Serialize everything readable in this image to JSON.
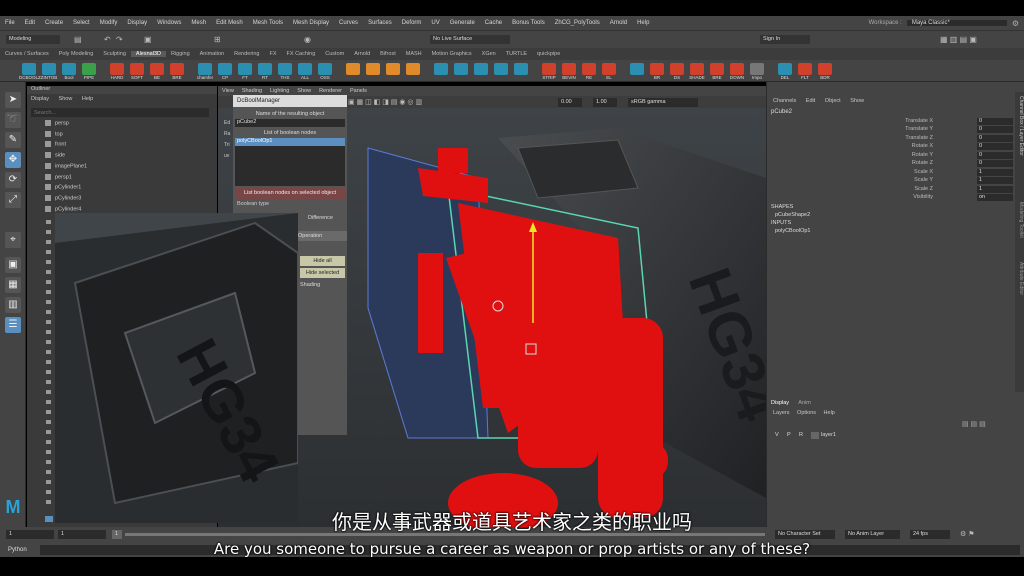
{
  "menu": [
    "File",
    "Edit",
    "Create",
    "Select",
    "Modify",
    "Display",
    "Windows",
    "Mesh",
    "Edit Mesh",
    "Mesh Tools",
    "Mesh Display",
    "Curves",
    "Surfaces",
    "Deform",
    "UV",
    "Generate",
    "Cache",
    "Bonus Tools",
    "ZhCG_PolyTools",
    "Arnold",
    "Help"
  ],
  "workspace": {
    "label": "Workspace :",
    "value": "Maya Classic*"
  },
  "status": {
    "mode": "Modeling",
    "no_live_surface": "No Live Surface",
    "sign_in": "Sign In"
  },
  "shelf_tabs": [
    "Curves / Surfaces",
    "Poly Modeling",
    "Sculpting",
    "Alesnal3D",
    "Rigging",
    "Animation",
    "Rendering",
    "FX",
    "FX Caching",
    "Custom",
    "Arnold",
    "Bifrost",
    "MASH",
    "Motion Graphics",
    "XGen",
    "TURTLE",
    "quickpipe"
  ],
  "shelf_active": 3,
  "shelf_icons": [
    {
      "label": "DCBOOLZ",
      "color": "#2a8fb0"
    },
    {
      "label": "ZINTOB",
      "color": "#2a8fb0"
    },
    {
      "label": "Bool",
      "color": "#2a8fb0"
    },
    {
      "label": "PIPE",
      "color": "#3aa04a"
    },
    {
      "label": "HARD",
      "color": "#d0402a"
    },
    {
      "label": "SOFT",
      "color": "#d0402a"
    },
    {
      "label": "BE",
      "color": "#d0402a"
    },
    {
      "label": "BRE",
      "color": "#d0402a"
    },
    {
      "label": "chamfer",
      "color": "#2a8fb0"
    },
    {
      "label": "CP",
      "color": "#2a8fb0"
    },
    {
      "label": "FT",
      "color": "#2a8fb0"
    },
    {
      "label": "RT",
      "color": "#2a8fb0"
    },
    {
      "label": "THS",
      "color": "#2a8fb0"
    },
    {
      "label": "ALL",
      "color": "#2a8fb0"
    },
    {
      "label": "OSS",
      "color": "#2a8fb0"
    },
    {
      "label": "",
      "color": "#e08a2a"
    },
    {
      "label": "",
      "color": "#e08a2a"
    },
    {
      "label": "",
      "color": "#e08a2a"
    },
    {
      "label": "",
      "color": "#e08a2a"
    },
    {
      "label": "",
      "color": "#2a8fb0"
    },
    {
      "label": "",
      "color": "#2a8fb0"
    },
    {
      "label": "",
      "color": "#2a8fb0"
    },
    {
      "label": "",
      "color": "#2a8fb0"
    },
    {
      "label": "",
      "color": "#2a8fb0"
    },
    {
      "label": "STRIP",
      "color": "#d0402a"
    },
    {
      "label": "BEVIN",
      "color": "#d0402a"
    },
    {
      "label": "RE",
      "color": "#d0402a"
    },
    {
      "label": "EL",
      "color": "#d0402a"
    },
    {
      "label": "",
      "color": "#2a8fb0"
    },
    {
      "label": "BR",
      "color": "#d0402a"
    },
    {
      "label": "DS",
      "color": "#d0402a"
    },
    {
      "label": "SHADE",
      "color": "#d0402a"
    },
    {
      "label": "BRE",
      "color": "#d0402a"
    },
    {
      "label": "DOWN",
      "color": "#d0402a"
    },
    {
      "label": "Impo",
      "color": "#777"
    },
    {
      "label": "DEL",
      "color": "#2a8fb0"
    },
    {
      "label": "FLT",
      "color": "#d0402a"
    },
    {
      "label": "BDR",
      "color": "#d0402a"
    }
  ],
  "outliner": {
    "title": "Outliner",
    "menu": [
      "Display",
      "Show",
      "Help"
    ],
    "search_placeholder": "Search...",
    "items": [
      "persp",
      "top",
      "front",
      "side",
      "imagePlane1",
      "persp1",
      "pCylinder1",
      "pCylinder3",
      "pCylinder4"
    ]
  },
  "viewport": {
    "menu": [
      "View",
      "Shading",
      "Lighting",
      "Show",
      "Renderer",
      "Panels"
    ],
    "field_a": "0.00",
    "field_b": "1.00",
    "color_space": "sRGB gamma"
  },
  "bool_manager": {
    "title": "DcBoolManager",
    "result_label": "Name of the resulting object",
    "result_value": "pCube2",
    "list_label": "List of boolean nodes",
    "list_item": "polyCBoolOp1",
    "btn_list_selected": "List boolean nodes on selected object",
    "boolean_type": "Boolean type",
    "difference": "Difference",
    "operation": "Operation",
    "hide_all": "Hide all",
    "hide_selected": "Hide selected",
    "shading": "Shading",
    "side_letters": [
      "Ed",
      "Ra",
      "Tri",
      "uv"
    ]
  },
  "channel_box": {
    "menu": [
      "Channels",
      "Edit",
      "Object",
      "Show"
    ],
    "object": "pCube2",
    "attrs": [
      {
        "name": "Translate X",
        "value": "0"
      },
      {
        "name": "Translate Y",
        "value": "0"
      },
      {
        "name": "Translate Z",
        "value": "0"
      },
      {
        "name": "Rotate X",
        "value": "0"
      },
      {
        "name": "Rotate Y",
        "value": "0"
      },
      {
        "name": "Rotate Z",
        "value": "0"
      },
      {
        "name": "Scale X",
        "value": "1"
      },
      {
        "name": "Scale Y",
        "value": "1"
      },
      {
        "name": "Scale Z",
        "value": "1"
      },
      {
        "name": "Visibility",
        "value": "on"
      }
    ],
    "shapes_header": "SHAPES",
    "shape": "pCubeShape2",
    "inputs_header": "INPUTS",
    "input": "polyCBoolOp1",
    "side_tabs": [
      "Channel Box / Layer Editor",
      "Modeling Toolkit",
      "Attribute Editor"
    ]
  },
  "layers": {
    "tabs": [
      "Display",
      "Anim"
    ],
    "menu": [
      "Layers",
      "Options",
      "Help"
    ],
    "row": {
      "v": "V",
      "p": "P",
      "r": "R",
      "name": "layer1"
    }
  },
  "bottom": {
    "frame_start": "1",
    "frame_current": "1",
    "frame_box": "1",
    "no_character_set": "No Character Set",
    "no_anim_layer": "No Anim Layer",
    "fps": "24 fps",
    "script_lang": "Python"
  },
  "model_text": "HG34",
  "subtitle": {
    "zh": "你是从事武器或道具艺术家之类的职业吗",
    "en": "Are you someone to pursue a career as weapon or prop artists or any of these?"
  }
}
